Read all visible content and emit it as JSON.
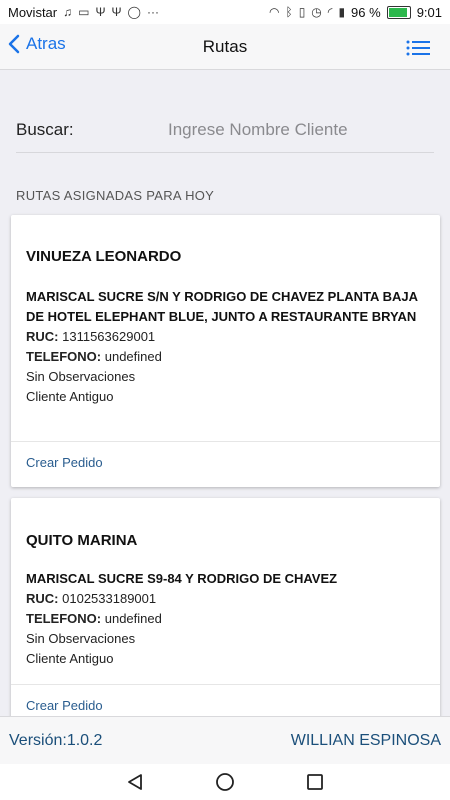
{
  "statusbar": {
    "carrier": "Movistar",
    "battery": "96 %",
    "time": "9:01"
  },
  "navbar": {
    "back_label": "Atras",
    "title": "Rutas"
  },
  "search": {
    "label": "Buscar:",
    "placeholder": "Ingrese Nombre Cliente",
    "value": ""
  },
  "section": {
    "header": "RUTAS ASIGNADAS PARA HOY"
  },
  "routes": [
    {
      "name": "VINUEZA LEONARDO",
      "address": "MARISCAL SUCRE S/N Y RODRIGO DE CHAVEZ PLANTA BAJA DE HOTEL ELEPHANT BLUE, JUNTO A RESTAURANTE BRYAN",
      "ruc_label": "RUC:",
      "ruc": "1311563629001",
      "phone_label": "TELEFONO:",
      "phone": "undefined",
      "observations": "Sin Observaciones",
      "client_type": "Cliente Antiguo",
      "action": "Crear Pedido"
    },
    {
      "name": "QUITO MARINA",
      "address": "MARISCAL SUCRE S9-84 Y RODRIGO DE CHAVEZ",
      "ruc_label": "RUC:",
      "ruc": "0102533189001",
      "phone_label": "TELEFONO:",
      "phone": "undefined",
      "observations": "Sin Observaciones",
      "client_type": "Cliente Antiguo",
      "action": "Crear Pedido"
    }
  ],
  "footer": {
    "version_label": "Versión:",
    "version": "1.0.2",
    "user": "WILLIAN ESPINOSA"
  },
  "colors": {
    "accent": "#1a73e8",
    "link": "#2a5d8f",
    "footer_text": "#1b4f7a",
    "battery": "#2db84d"
  }
}
